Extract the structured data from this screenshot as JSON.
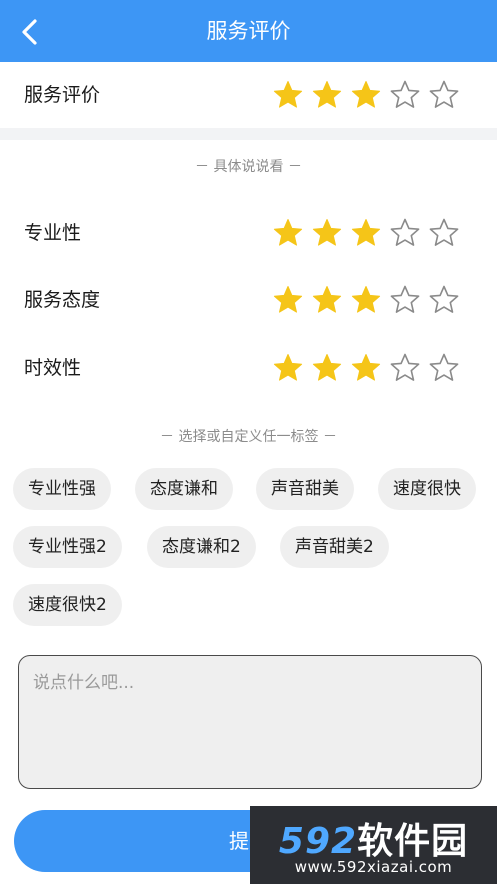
{
  "header": {
    "title": "服务评价"
  },
  "overall": {
    "label": "服务评价",
    "rating": 3,
    "max": 5
  },
  "detail_caption": "－ 具体说说看 －",
  "criteria": [
    {
      "label": "专业性",
      "rating": 3,
      "max": 5
    },
    {
      "label": "服务态度",
      "rating": 3,
      "max": 5
    },
    {
      "label": "时效性",
      "rating": 3,
      "max": 5
    }
  ],
  "tags_caption": "－ 选择或自定义任一标签 －",
  "tags": [
    "专业性强",
    "态度谦和",
    "声音甜美",
    "速度很快",
    "专业性强2",
    "态度谦和2",
    "声音甜美2",
    "速度很快2"
  ],
  "comment": {
    "placeholder": "说点什么吧..."
  },
  "submit": {
    "label": "提交"
  },
  "watermark": {
    "brand_num": "592",
    "brand_cn": "软件园",
    "url": "www.592xiazai.com"
  },
  "colors": {
    "primary": "#3d96f5",
    "star_filled": "#f5c518",
    "star_empty": "#8a8a8a",
    "tag_bg": "#efefef"
  }
}
